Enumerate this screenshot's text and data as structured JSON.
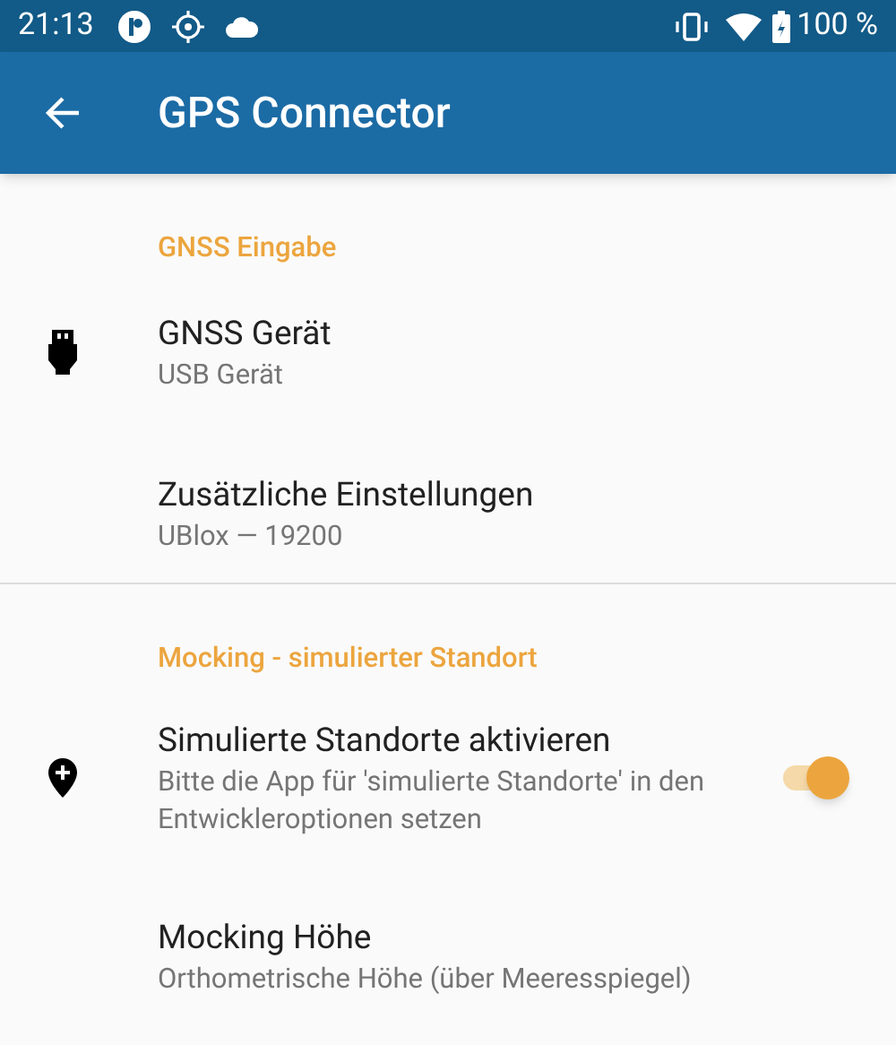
{
  "status_bar": {
    "time": "21:13",
    "battery": "100 %"
  },
  "toolbar": {
    "title": "GPS Connector"
  },
  "sections": [
    {
      "header": "GNSS Eingabe",
      "items": [
        {
          "kind": "plain",
          "title": "GNSS Gerät",
          "summary": "USB Gerät"
        },
        {
          "kind": "plain",
          "title": "Zusätzliche Einstellungen",
          "summary": "UBlox — 19200"
        }
      ]
    },
    {
      "header": "Mocking - simulierter Standort",
      "items": [
        {
          "kind": "switch",
          "title": "Simulierte Standorte aktivieren",
          "summary": "Bitte die App für 'simulierte Standorte' in den Entwickleroptionen setzen",
          "on": true
        },
        {
          "kind": "plain",
          "title": "Mocking Höhe",
          "summary": "Orthometrische Höhe (über Meeresspiegel)"
        }
      ]
    }
  ]
}
